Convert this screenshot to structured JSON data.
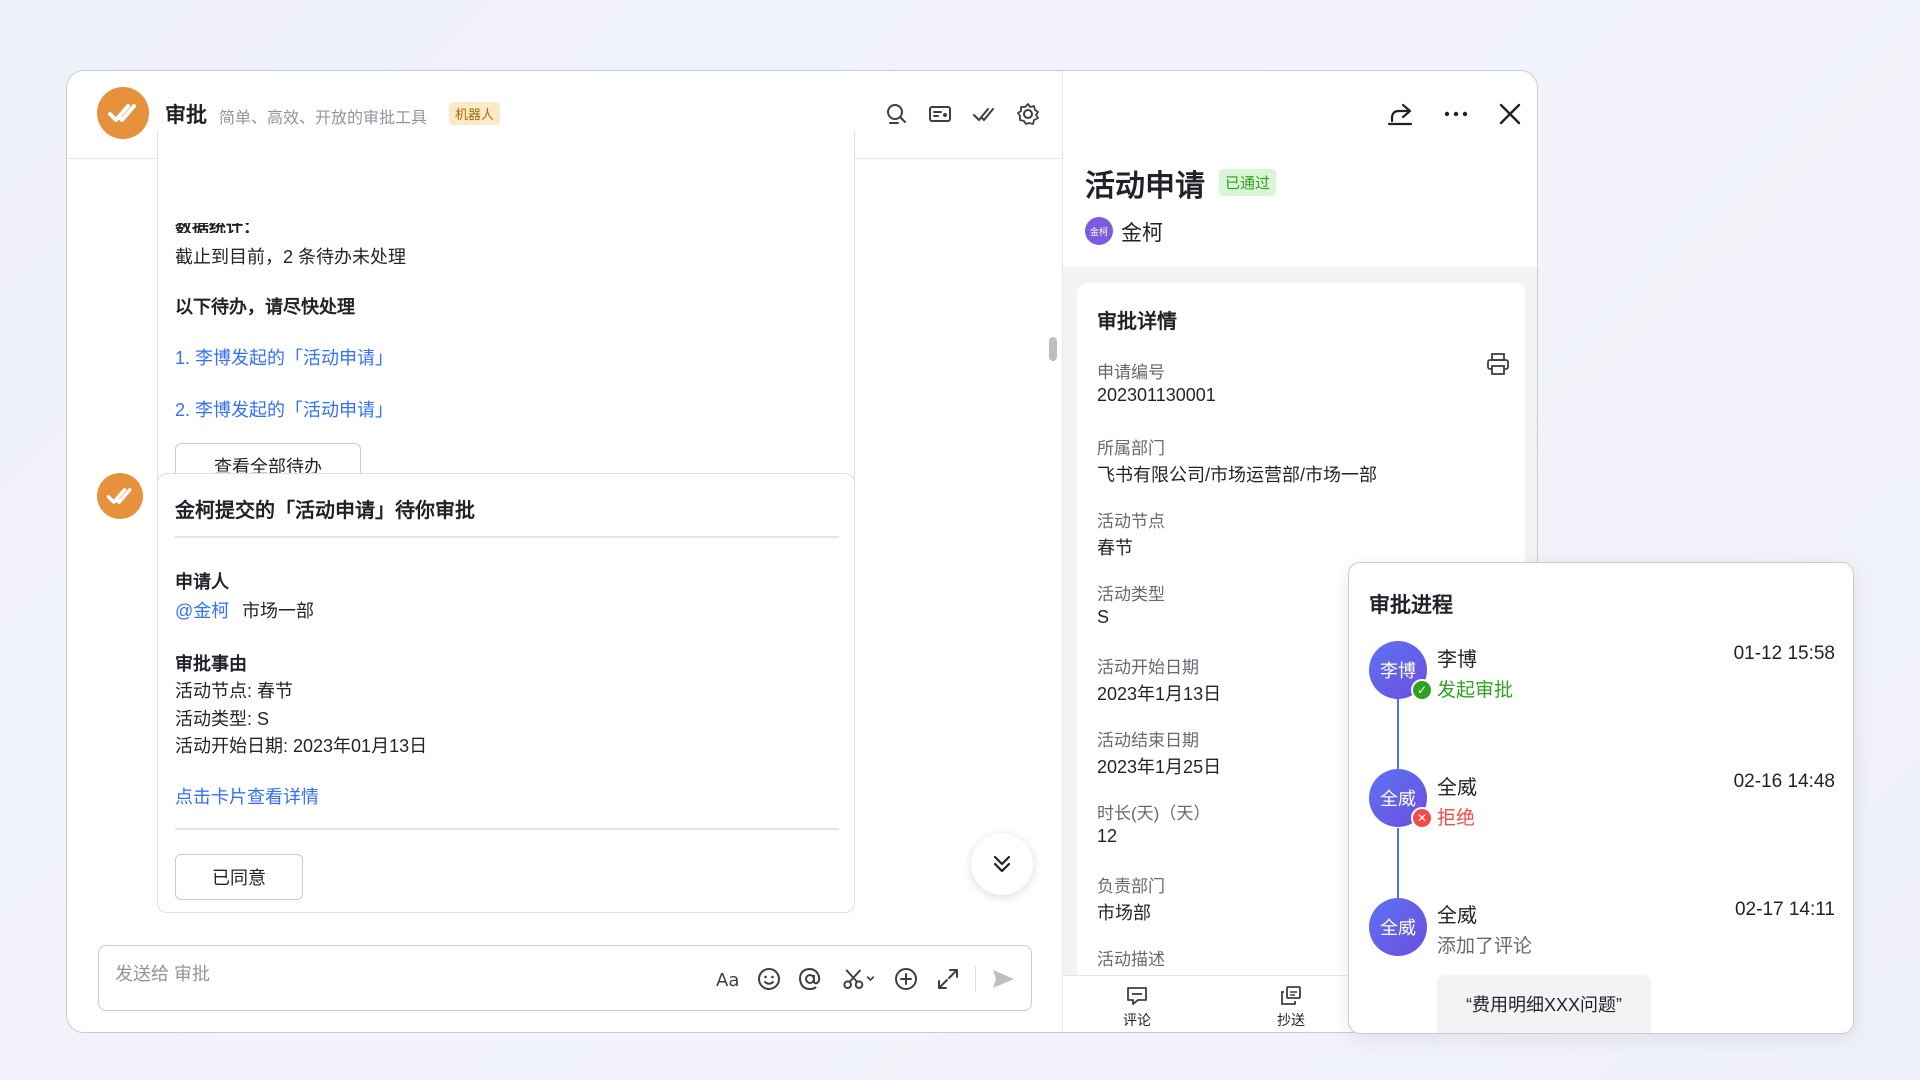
{
  "chat": {
    "title": "审批",
    "description": "简单、高效、开放的审批工具",
    "bot_tag": "机器人",
    "card1": {
      "stats_heading": "数据统计：",
      "stats_text": "截止到目前，2 条待办未处理",
      "todo_heading": "以下待办，请尽快处理",
      "items": [
        "1. 李博发起的「活动申请」",
        "2. 李博发起的「活动申请」"
      ],
      "button": "查看全部待办"
    },
    "card2": {
      "title": "金柯提交的「活动申请」待你审批",
      "applicant_label": "申请人",
      "applicant_mention": "@金柯",
      "applicant_dept": "市场一部",
      "reason_label": "审批事由",
      "reason_lines": [
        "活动节点: 春节",
        "活动类型: S",
        "活动开始日期: 2023年01月13日"
      ],
      "detail_link": "点击卡片查看详情",
      "button": "已同意"
    },
    "input_placeholder": "发送给 审批"
  },
  "detail": {
    "title": "活动申请",
    "status": "已通过",
    "user_avatar": "金柯",
    "user": "金柯",
    "section_title": "审批详情",
    "fields": [
      {
        "label": "申请编号",
        "value": "202301130001"
      },
      {
        "label": "所属部门",
        "value": "飞书有限公司/市场运营部/市场一部"
      },
      {
        "label": "活动节点",
        "value": "春节"
      },
      {
        "label": "活动类型",
        "value": "S"
      },
      {
        "label": "活动开始日期",
        "value": "2023年1月13日"
      },
      {
        "label": "活动结束日期",
        "value": "2023年1月25日"
      },
      {
        "label": "时长(天)（天）",
        "value": "12"
      },
      {
        "label": "负责部门",
        "value": "市场部"
      },
      {
        "label": "活动描述",
        "value": ""
      }
    ],
    "bottom_actions": [
      "评论",
      "抄送"
    ]
  },
  "progress": {
    "title": "审批进程",
    "steps": [
      {
        "avatar": "李博",
        "name": "李博",
        "action": "发起审批",
        "time": "01-12 15:58",
        "status": "approved",
        "color": "#2ea121"
      },
      {
        "avatar": "全威",
        "name": "全威",
        "action": "拒绝",
        "time": "02-16 14:48",
        "status": "rejected",
        "color": "#f54a45"
      },
      {
        "avatar": "全威",
        "name": "全威",
        "action": "添加了评论",
        "time": "02-17 14:11",
        "status": "comment",
        "color": "#646a73"
      }
    ],
    "comment": "“费用明细XXX问题”"
  },
  "colors": {
    "accent": "#3370ff",
    "bot": "#e8913c",
    "approved": "#2ea121",
    "rejected": "#f54a45"
  }
}
